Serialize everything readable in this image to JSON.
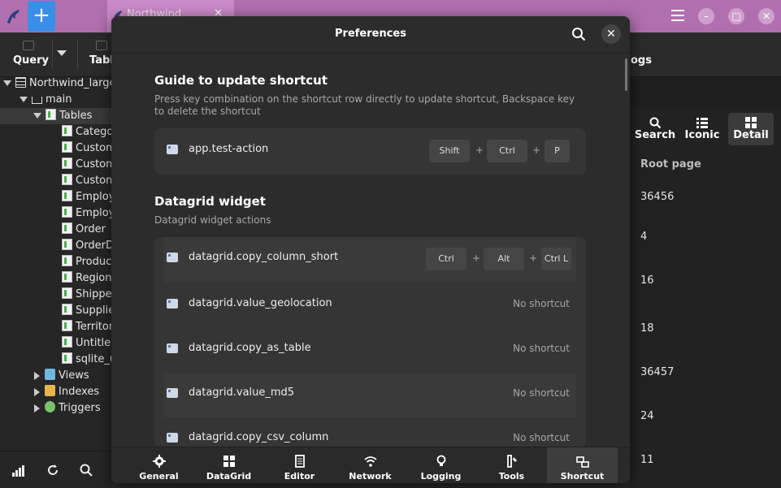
{
  "titlebar": {
    "new_tab_symbol": "+",
    "tab": {
      "label": "Northwind",
      "close_symbol": "✕"
    },
    "window_controls": {
      "minimize": "–",
      "maximize": "□",
      "close": "✕"
    }
  },
  "toolbar": {
    "query_label": "Query",
    "table_label": "Table",
    "logs_label": "ogs"
  },
  "sidebar": {
    "root": "Northwind_large.",
    "schema": "main",
    "tables_group": "Tables",
    "tables": [
      "Categor",
      "Custom",
      "Custom",
      "Custom",
      "Employe",
      "Employe",
      "Order",
      "OrderDe",
      "Product",
      "Region",
      "Shipper",
      "Supplier",
      "Territory",
      "Untitled",
      "sqlite_u"
    ],
    "groups": [
      "Views",
      "Indexes",
      "Triggers"
    ]
  },
  "right_panel": {
    "views": [
      {
        "label": "Search",
        "icon": "search-icon"
      },
      {
        "label": "Iconic",
        "icon": "list-icon"
      },
      {
        "label": "Detail",
        "icon": "grid-icon"
      }
    ],
    "column_header": "Root page",
    "values": [
      "36456",
      "4",
      "16",
      "18",
      "36457",
      "24",
      "11"
    ]
  },
  "dialog": {
    "title": "Preferences",
    "close_symbol": "✕",
    "guide": {
      "title": "Guide to update shortcut",
      "description": "Press key combination on the shortcut row directly to update shortcut, Backspace key to delete the shortcut",
      "row": {
        "label": "app.test-action",
        "keys": [
          "Shift",
          "Ctrl",
          "P"
        ]
      }
    },
    "datagrid": {
      "title": "Datagrid widget",
      "description": "Datagrid widget actions",
      "rows": [
        {
          "label": "datagrid.copy_column_short",
          "keys": [
            "Ctrl",
            "Alt",
            "Ctrl L"
          ]
        },
        {
          "label": "datagrid.value_geolocation",
          "shortcut": "No shortcut"
        },
        {
          "label": "datagrid.copy_as_table",
          "shortcut": "No shortcut"
        },
        {
          "label": "datagrid.value_md5",
          "shortcut": "No shortcut"
        },
        {
          "label": "datagrid.copy_csv_column",
          "shortcut": "No shortcut"
        }
      ]
    },
    "plus_symbol": "+",
    "tabs": [
      {
        "label": "General",
        "icon": "gear-icon"
      },
      {
        "label": "DataGrid",
        "icon": "grid-icon"
      },
      {
        "label": "Editor",
        "icon": "document-icon"
      },
      {
        "label": "Network",
        "icon": "wifi-icon"
      },
      {
        "label": "Logging",
        "icon": "lightbulb-icon"
      },
      {
        "label": "Tools",
        "icon": "tools-icon"
      },
      {
        "label": "Shortcut",
        "icon": "shortcut-icon",
        "active": true
      }
    ]
  }
}
